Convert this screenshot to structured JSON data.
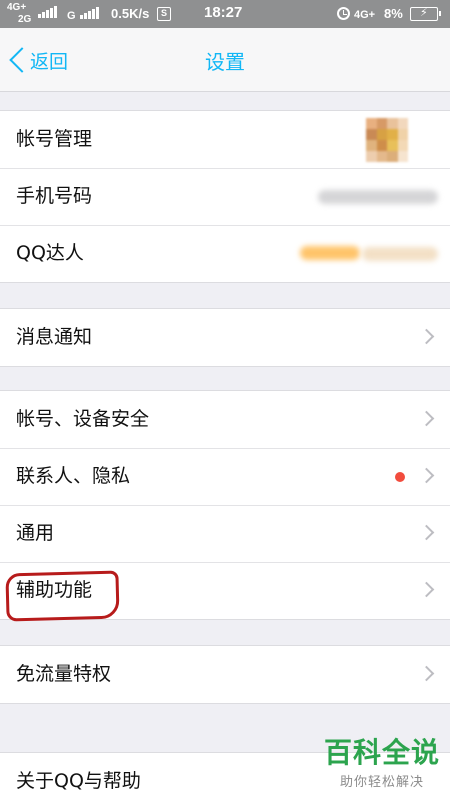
{
  "status_bar": {
    "sim1_network": "4G+",
    "sim1_type": "2G",
    "sim2_network": "G",
    "speed": "0.5K/s",
    "time": "18:27",
    "right_network": "4G+",
    "battery": "8%",
    "icons": [
      "signal-icon",
      "data-saver-icon",
      "alarm-icon",
      "battery-charging-icon"
    ]
  },
  "nav": {
    "back_label": "返回",
    "title": "设置",
    "accent_color": "#12b7f5"
  },
  "groups": [
    {
      "rows": [
        {
          "label": "帐号管理"
        },
        {
          "label": "手机号码"
        },
        {
          "label": "QQ达人"
        }
      ]
    },
    {
      "rows": [
        {
          "label": "消息通知"
        }
      ]
    },
    {
      "rows": [
        {
          "label": "帐号、设备安全"
        },
        {
          "label": "联系人、隐私",
          "badge_color": "#f24c3d"
        },
        {
          "label": "通用"
        },
        {
          "label": "辅助功能"
        }
      ]
    },
    {
      "rows": [
        {
          "label": "免流量特权"
        }
      ]
    },
    {
      "rows": [
        {
          "label": "关于QQ与帮助"
        }
      ]
    }
  ],
  "watermark": {
    "main": "百科全说",
    "sub": "助你轻松解决"
  }
}
